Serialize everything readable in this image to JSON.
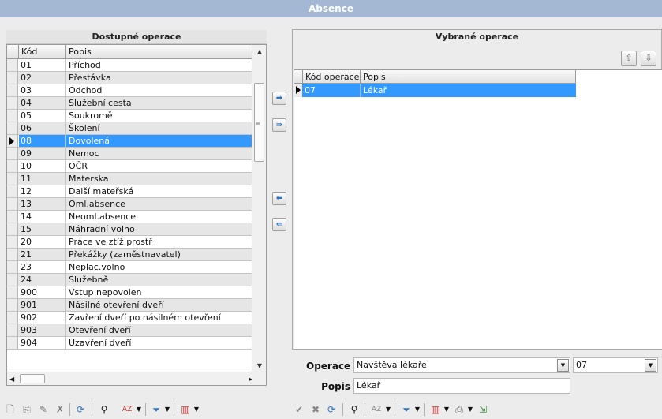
{
  "window": {
    "title": "Absence"
  },
  "left": {
    "header": "Dostupné operace",
    "columns": {
      "kod": "Kód",
      "popis": "Popis"
    },
    "rows": [
      {
        "k": "01",
        "p": "Příchod"
      },
      {
        "k": "02",
        "p": "Přestávka"
      },
      {
        "k": "03",
        "p": "Odchod"
      },
      {
        "k": "04",
        "p": "Služební cesta"
      },
      {
        "k": "05",
        "p": "Soukromě"
      },
      {
        "k": "06",
        "p": "Školení"
      },
      {
        "k": "08",
        "p": "Dovolená"
      },
      {
        "k": "09",
        "p": "Nemoc"
      },
      {
        "k": "10",
        "p": "OČR"
      },
      {
        "k": "11",
        "p": "Materska"
      },
      {
        "k": "12",
        "p": "Další mateřská"
      },
      {
        "k": "13",
        "p": "Oml.absence"
      },
      {
        "k": "14",
        "p": "Neoml.absence"
      },
      {
        "k": "15",
        "p": "Náhradní volno"
      },
      {
        "k": "20",
        "p": "Práce ve ztíž.prostř"
      },
      {
        "k": "21",
        "p": "Překážky (zaměstnavatel)"
      },
      {
        "k": "23",
        "p": "Neplac.volno"
      },
      {
        "k": "24",
        "p": "Služebně"
      },
      {
        "k": "900",
        "p": "Vstup nepovolen"
      },
      {
        "k": "901",
        "p": "Násilné otevření dveří"
      },
      {
        "k": "902",
        "p": "Zavření dveří po násilném otevření"
      },
      {
        "k": "903",
        "p": "Otevření dveří"
      },
      {
        "k": "904",
        "p": "Uzavření dveří"
      }
    ],
    "selected_code": "08"
  },
  "right": {
    "header": "Vybrané operace",
    "columns": {
      "kod": "Kód operace",
      "popis": "Popis"
    },
    "rows": [
      {
        "k": "07",
        "p": "Lékař"
      }
    ]
  },
  "form": {
    "operace_label": "Operace",
    "operace_value": "Navštěva lékaře",
    "operace_code": "07",
    "popis_label": "Popis",
    "popis_value": "Lékař"
  },
  "icons": {
    "move_right": "arrow-right-icon",
    "move_all_right": "double-arrow-right-icon",
    "move_left": "arrow-left-icon",
    "move_all_left": "double-arrow-left-icon",
    "sort_up": "arrow-up-icon",
    "sort_down": "arrow-down-icon"
  }
}
